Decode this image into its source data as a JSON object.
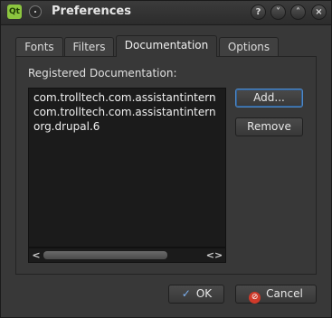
{
  "window": {
    "title": "Preferences",
    "app_icon_text": "Qt"
  },
  "titlebar_buttons": [
    "?",
    "˅",
    "˄",
    "×"
  ],
  "tabs": [
    {
      "label": "Fonts"
    },
    {
      "label": "Filters"
    },
    {
      "label": "Documentation",
      "active": true
    },
    {
      "label": "Options"
    }
  ],
  "documentation": {
    "label": "Registered Documentation:",
    "items": [
      "com.trolltech.com.assistantintern",
      "com.trolltech.com.assistantintern",
      "org.drupal.6"
    ],
    "add_label": "Add...",
    "remove_label": "Remove"
  },
  "scrollbar": {
    "left_arrow": "<",
    "right_arrows": "<>"
  },
  "footer": {
    "ok_label": "OK",
    "cancel_label": "Cancel"
  }
}
